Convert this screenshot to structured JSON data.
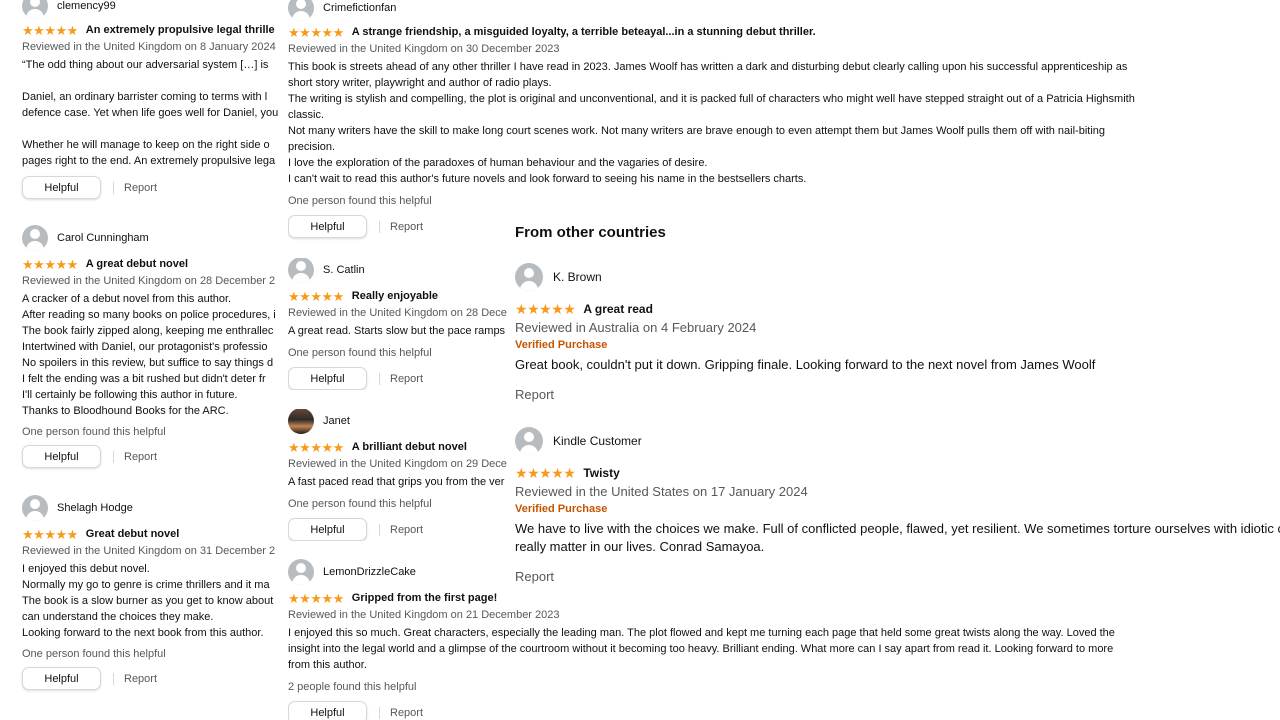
{
  "colors": {
    "star": "#f79a1a",
    "verified": "#c45500",
    "muted": "#565959"
  },
  "common": {
    "helpful_label": "Helpful",
    "report_label": "Report"
  },
  "col_a": {
    "reviews": [
      {
        "author": "clemency99",
        "title": "An extremely propulsive legal thrille",
        "meta": "Reviewed in the United Kingdom on 8 January 2024",
        "body": [
          "“The odd thing about our adversarial system […] is",
          "",
          "Daniel, an ordinary barrister coming to terms with l",
          "defence case. Yet when life goes well for Daniel, you",
          "",
          "Whether he will manage to keep on the right side o",
          "pages right to the end. An extremely propulsive lega"
        ]
      },
      {
        "author": "Carol Cunningham",
        "title": "A great debut novel",
        "meta": "Reviewed in the United Kingdom on 28 December 2",
        "body": [
          "A cracker of a debut novel from this author.",
          "After reading so many books on police procedures, i",
          "The book fairly zipped along, keeping me enthrallec",
          "Intertwined with Daniel, our protagonist's professio",
          "No spoilers in this review, but suffice to say things d",
          "I felt the ending was a bit rushed but didn't deter fr",
          "I'll certainly be following this author in future.",
          "Thanks to Bloodhound Books for the ARC."
        ],
        "helpful_count": "One person found this helpful"
      },
      {
        "author": "Shelagh Hodge",
        "title": "Great debut novel",
        "meta": "Reviewed in the United Kingdom on 31 December 2",
        "body": [
          "I enjoyed this debut novel.",
          "Normally my go to genre is crime thrillers and it ma",
          "The book is a slow burner as you get to know about",
          "can understand the choices they make.",
          "Looking forward to the next book from this author."
        ],
        "helpful_count": "One person found this helpful"
      }
    ]
  },
  "col_b": {
    "reviews": [
      {
        "author": "Crimefictionfan",
        "title": "A strange friendship, a misguided loyalty, a terrible beteayal...in a stunning debut thriller.",
        "meta": "Reviewed in the United Kingdom on 30 December 2023",
        "body": [
          "This book is streets ahead of any other thriller I have read in 2023. James Woolf has written a dark and disturbing debut clearly calling upon his successful apprenticeship as",
          "short story writer, playwright and author of radio plays.",
          "The writing is stylish and compelling, the plot is original and unconventional, and it is packed full of characters who might well have stepped straight out of a Patricia Highsmith",
          "classic.",
          "Not many writers have the skill to make long court scenes work. Not many writers are brave enough to even attempt them but James Woolf pulls them off with nail-biting",
          "precision.",
          "I love the exploration of the paradoxes of human behaviour and the vagaries of desire.",
          "I can't wait to read this author's future novels and look forward to seeing his name in the bestsellers charts."
        ],
        "helpful_count": "One person found this helpful"
      },
      {
        "author": "S. Catlin",
        "title": "Really enjoyable",
        "meta": "Reviewed in the United Kingdom on 28 Dece",
        "body": [
          "A great read. Starts slow but the pace ramps"
        ],
        "helpful_count": "One person found this helpful"
      },
      {
        "author": "Janet",
        "title": "A brilliant debut novel",
        "meta": "Reviewed in the United Kingdom on 29 Dece",
        "body": [
          "A fast paced read that grips you from the ver"
        ],
        "helpful_count": "One person found this helpful"
      },
      {
        "author": "LemonDrizzleCake",
        "title": "Gripped from the first page!",
        "meta": "Reviewed in the United Kingdom on 21 December 2023",
        "body": [
          "I enjoyed this so much. Great characters, especially the leading man. The plot flowed and kept me turning each page that held some great twists along the way. Loved the",
          "insight into the legal world and a glimpse of the courtroom without it becoming too heavy. Brilliant ending. What more can I say apart from read it. Looking forward to more",
          "from this author."
        ],
        "helpful_count": "2 people found this helpful"
      }
    ]
  },
  "col_c": {
    "section_title": "From other countries",
    "reviews": [
      {
        "author": "K. Brown",
        "title": "A great read",
        "meta": "Reviewed in Australia on 4 February 2024",
        "verified": "Verified Purchase",
        "body": [
          "Great book, couldn't put it down. Gripping finale. Looking forward to the next novel from James Woolf"
        ]
      },
      {
        "author": "Kindle Customer",
        "title": "Twisty",
        "meta": "Reviewed in the United States on 17 January 2024",
        "verified": "Verified Purchase",
        "body": [
          "We have to live with the choices we make. Full of conflicted people, flawed, yet resilient. We sometimes torture ourselves with idiotic c",
          "really matter in our lives. Conrad Samayoa."
        ]
      }
    ]
  }
}
